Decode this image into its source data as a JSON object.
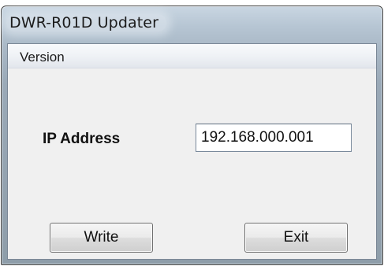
{
  "window": {
    "title": "DWR-R01D Updater"
  },
  "menu": {
    "version_label": "Version"
  },
  "form": {
    "ip_label": "IP Address",
    "ip_value": "192.168.000.001"
  },
  "buttons": {
    "write_label": "Write",
    "exit_label": "Exit"
  }
}
